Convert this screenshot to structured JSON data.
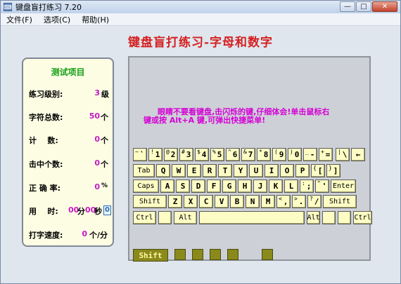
{
  "window": {
    "title": "键盘盲打练习 7.20",
    "icon": "keyboard-app-icon",
    "controls": {
      "minimize": "—",
      "maximize": "□",
      "close": "✕"
    }
  },
  "menu": [
    "文件(F)",
    "选项(C)",
    "帮助(H)"
  ],
  "main_title": "键盘盲打练习-字母和数字",
  "stats": {
    "title": "测试项目",
    "level_label": "练习级别:",
    "level_value": "3",
    "level_unit": "级",
    "total_label": "字符总数:",
    "total_value": "50",
    "total_unit": "个",
    "count_label": "计    数:",
    "count_value": "0",
    "count_unit": "个",
    "hit_label": "击中个数:",
    "hit_value": "0",
    "hit_unit": "个",
    "accuracy_label": "正 确 率:",
    "accuracy_value": "0",
    "accuracy_unit": "%",
    "time_label": "用    时:",
    "time_min": "00",
    "time_min_unit": "分",
    "time_sec": "00",
    "time_sec_unit": "秒",
    "blink": "0",
    "speed_label": "打字速度:",
    "speed_value": "0",
    "speed_unit": "个/分"
  },
  "instructions": {
    "line1": "眼睛不要看键盘,击闪烁的键,仔细体会!单击鼠标右",
    "line2": "键或按 Alt+A 键,可弹出快捷菜单!"
  },
  "keyboard": {
    "row1": [
      "~`",
      "!1",
      "@2",
      "#3",
      "$4",
      "%5",
      "^6",
      "&7",
      "*8",
      "(9",
      ")0",
      "_-",
      "+=",
      "|\\",
      "←"
    ],
    "row2": [
      "Tab",
      "Q",
      "W",
      "E",
      "R",
      "T",
      "Y",
      "U",
      "I",
      "O",
      "P",
      "{[",
      "}]"
    ],
    "row3": [
      "Caps",
      "A",
      "S",
      "D",
      "F",
      "G",
      "H",
      "J",
      "K",
      "L",
      ":;",
      "\"'",
      "Enter"
    ],
    "row4": [
      "Shift",
      "Z",
      "X",
      "C",
      "V",
      "B",
      "N",
      "M",
      "<,",
      ">.",
      "?/",
      "Shift"
    ],
    "row5": [
      "Ctrl",
      "",
      "Alt",
      "",
      "Alt",
      "",
      "",
      "Ctrl"
    ]
  },
  "indicator": {
    "shift_label": "Shift"
  }
}
